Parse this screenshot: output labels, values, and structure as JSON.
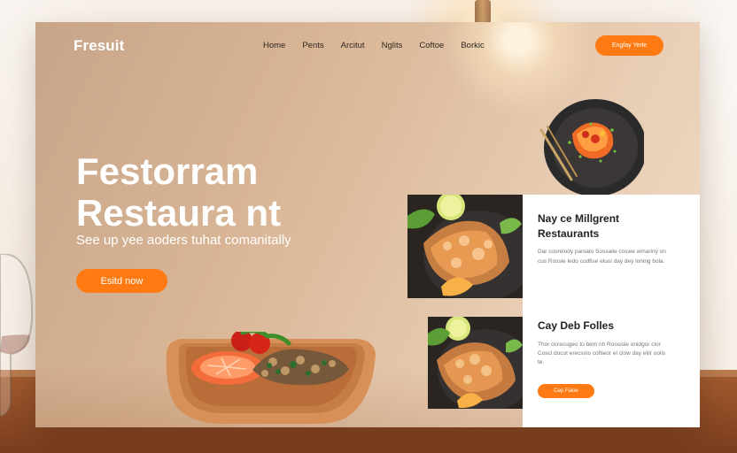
{
  "site": {
    "brand": "Fresuit",
    "nav": [
      "Home",
      "Pents",
      "Arcitut",
      "Nglits",
      "Coftoe",
      "Borkic"
    ],
    "top_cta": "Engfay Yerle"
  },
  "hero": {
    "title_line1": "Festorram",
    "title_line2": "Restaura nt",
    "subtitle": "See up yee aoders tuhat comanitally",
    "button": "Esitd now"
  },
  "features": [
    {
      "title": "Nay ce Millgrent Restaurants",
      "body": "Dar cosrelody paniato Sossaile coswe wmariny on cus Rossie ledo codfise eluoi day dey loning bola."
    },
    {
      "title": "Cay Deb Folles",
      "body": "Thor ocrecugeo to bem nh Roosisle onidgor clor Cosci docot erecsnis coftieor el clow day elilr oolis te.",
      "button": "Cep Faioe"
    }
  ],
  "colors": {
    "accent": "#ff7a12",
    "panel": "#d8b595",
    "card": "#ffffff",
    "text_dark": "#222222"
  }
}
